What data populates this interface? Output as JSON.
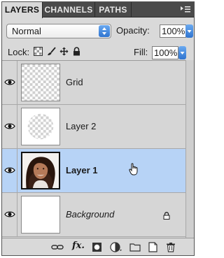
{
  "tabs": [
    {
      "label": "LAYERS",
      "active": true
    },
    {
      "label": "CHANNELS",
      "active": false
    },
    {
      "label": "PATHS",
      "active": false
    }
  ],
  "blend": {
    "mode": "Normal"
  },
  "opacity": {
    "label": "Opacity:",
    "value": "100%"
  },
  "lock": {
    "label": "Lock:",
    "icons": [
      "lock-transparent-icon",
      "lock-image-icon",
      "lock-position-icon",
      "lock-all-icon"
    ]
  },
  "fill": {
    "label": "Fill:",
    "value": "100%"
  },
  "layers": [
    {
      "name": "Grid",
      "visible": true,
      "selected": false,
      "thumbnail": "transparent-checker"
    },
    {
      "name": "Layer 2",
      "visible": true,
      "selected": false,
      "thumbnail": "circle-checker"
    },
    {
      "name": "Layer 1",
      "visible": true,
      "selected": true,
      "thumbnail": "portrait-photo"
    },
    {
      "name": "Background",
      "visible": true,
      "selected": false,
      "locked": true,
      "thumbnail": "white"
    }
  ],
  "colors": {
    "selected_row": "#b7d3f6",
    "panel_bg": "#d9d9d9",
    "tab_bar": "#4a4a4a",
    "accent_blue": "#2f74d0"
  },
  "toolbar": {
    "fx_label": "fx."
  }
}
